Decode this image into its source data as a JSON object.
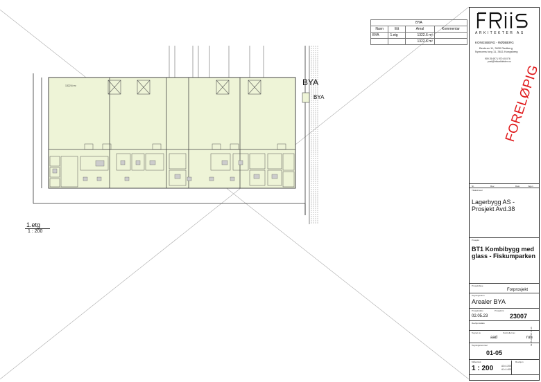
{
  "bya_table": {
    "title": "BYA",
    "headers": [
      "Navn",
      "Ett",
      "Areal",
      "Kommentar"
    ],
    "rows": [
      {
        "navn": "BYA",
        "etg": "1.etg",
        "areal": "1322.6 m²",
        "kommentar": ""
      },
      {
        "navn": "",
        "etg": "",
        "areal": "1322.6 m²",
        "kommentar": ""
      }
    ]
  },
  "plan": {
    "bya_label_large": "BYA",
    "bya_label_small": "BYA",
    "floor_title": "1.etg",
    "scale": "1 : 200",
    "room_label": "1322.6 m²"
  },
  "title_block": {
    "firm": "ARKITEKTER AS",
    "locations": "KONGSBERG - RØDBERG",
    "address1": "Bestrum 11, 3630 Rødberg",
    "address2": "Nymoens torg 11, 3611 Kongsberg",
    "phone": "909 25 697 | 970 45 076",
    "email": "post@friisarkitekter.no",
    "stamp": "FORELØPIG",
    "rev_headers": [
      "Nr.",
      "Rev.",
      "Dato",
      "Ingen"
    ],
    "client_label": "Tiltakshaver",
    "client": "Lagerbygg AS - Prosjekt Avd.38",
    "project_label": "Prosjekt",
    "project": "BT1 Kombibygg med glass - Fiskumparken",
    "phase_label": "Prosjektfase",
    "phase": "Forprosjekt",
    "drawing_label": "Tegningsnavn",
    "drawing": "Arealer BYA",
    "date_label": "Prosjektdato",
    "date": "02.05.23",
    "projno_label": "Prosjektnr.",
    "projno": "23007",
    "revdate_label": "Revisjonsdato",
    "drawn_label": "Tegnet av",
    "drawn": "aad",
    "checked_label": "Kontrollert av",
    "checked": "ruh",
    "sheet_label": "Tegningsnummer",
    "sheet": "01-05",
    "scale_label": "Målestokk",
    "scale": "1 : 200",
    "paper1": "A3=1:200",
    "paper2": "A1=1:400",
    "revision_label": "Revisjon",
    "timestamp": "02.05.2024 15:41:36"
  }
}
